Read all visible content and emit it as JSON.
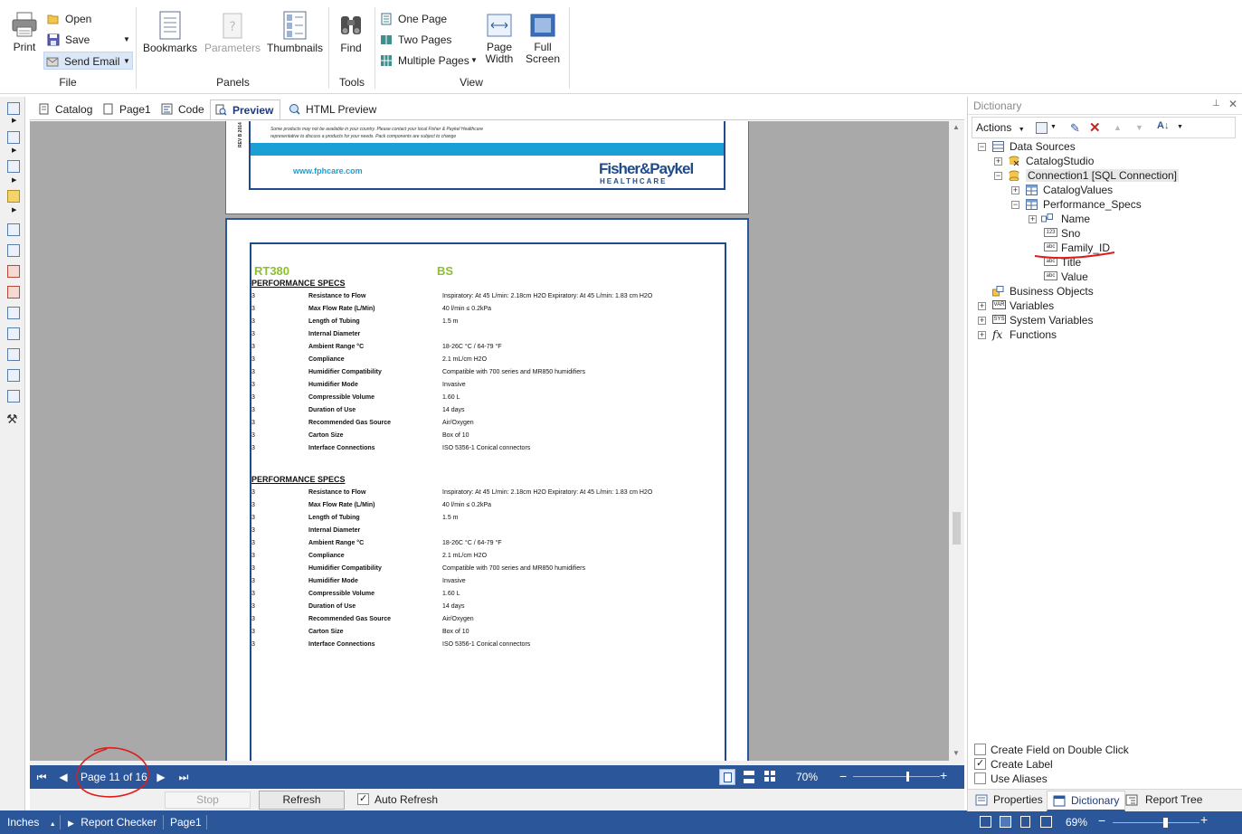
{
  "ribbon": {
    "print": "Print",
    "open": "Open",
    "save": "Save",
    "send_email": "Send Email",
    "file_group": "File",
    "bookmarks": "Bookmarks",
    "parameters": "Parameters",
    "thumbnails": "Thumbnails",
    "panels_group": "Panels",
    "find": "Find",
    "tools_group": "Tools",
    "one_page": "One Page",
    "two_pages": "Two Pages",
    "multiple_pages": "Multiple Pages",
    "page_width": "Page\nWidth",
    "page_width_l1": "Page",
    "page_width_l2": "Width",
    "full_screen_l1": "Full",
    "full_screen_l2": "Screen",
    "view_group": "View"
  },
  "tabs": [
    {
      "label": "Catalog"
    },
    {
      "label": "Page1"
    },
    {
      "label": "Code"
    },
    {
      "label": "Preview"
    },
    {
      "label": "HTML Preview"
    }
  ],
  "page_top": {
    "disclaimer1": "Some products may not be available in your country. Please contact your local Fisher & Paykel Healthcare",
    "disclaimer2": "representative to discuss a products for your needs. Pack components are subject to change",
    "website": "www.fphcare.com",
    "brand": "Fisher&Paykel",
    "brand_sub": "HEALTHCARE",
    "side_code": "REV B 2014"
  },
  "page_main": {
    "product": "RT380",
    "code": "BS",
    "sections": [
      {
        "heading": "PERFORMANCE SPECS",
        "rows": [
          {
            "n": "3",
            "name": "Resistance to Flow",
            "value": "Inspiratory: At 45 L/min: 2.18cm H2O Expiratory: At 45 L/min: 1.83 cm H2O"
          },
          {
            "n": "3",
            "name": "Max Flow Rate (L/Min)",
            "value": "40 l/min ≤ 0.2kPa"
          },
          {
            "n": "3",
            "name": "Length of Tubing",
            "value": "1.5 m"
          },
          {
            "n": "3",
            "name": "Internal Diameter",
            "value": ""
          },
          {
            "n": "3",
            "name": "Ambient Range °C",
            "value": "18-26C °C / 64-79 °F"
          },
          {
            "n": "3",
            "name": "Compliance",
            "value": "2.1 mL/cm H2O"
          },
          {
            "n": "3",
            "name": "Humidifier Compatibility",
            "value": "Compatible with 700 series and MR850 humidifiers"
          },
          {
            "n": "3",
            "name": "Humidifier Mode",
            "value": "Invasive"
          },
          {
            "n": "3",
            "name": "Compressible Volume",
            "value": "1.60 L"
          },
          {
            "n": "3",
            "name": "Duration of Use",
            "value": "14 days"
          },
          {
            "n": "3",
            "name": "Recommended Gas Source",
            "value": "Air/Oxygen"
          },
          {
            "n": "3",
            "name": "Carton Size",
            "value": "Box of 10"
          },
          {
            "n": "3",
            "name": "Interface Connections",
            "value": "ISO 5356-1 Conical connectors"
          }
        ]
      },
      {
        "heading": "PERFORMANCE SPECS",
        "rows": [
          {
            "n": "3",
            "name": "Resistance to Flow",
            "value": "Inspiratory: At 45 L/min: 2.18cm H2O Expiratory: At 45 L/min: 1.83 cm H2O"
          },
          {
            "n": "3",
            "name": "Max Flow Rate (L/Min)",
            "value": "40 l/min ≤ 0.2kPa"
          },
          {
            "n": "3",
            "name": "Length of Tubing",
            "value": "1.5 m"
          },
          {
            "n": "3",
            "name": "Internal Diameter",
            "value": ""
          },
          {
            "n": "3",
            "name": "Ambient Range °C",
            "value": "18-26C °C / 64-79 °F"
          },
          {
            "n": "3",
            "name": "Compliance",
            "value": "2.1 mL/cm H2O"
          },
          {
            "n": "3",
            "name": "Humidifier Compatibility",
            "value": "Compatible with 700 series and MR850 humidifiers"
          },
          {
            "n": "3",
            "name": "Humidifier Mode",
            "value": "Invasive"
          },
          {
            "n": "3",
            "name": "Compressible Volume",
            "value": "1.60 L"
          },
          {
            "n": "3",
            "name": "Duration of Use",
            "value": "14 days"
          },
          {
            "n": "3",
            "name": "Recommended Gas Source",
            "value": "Air/Oxygen"
          },
          {
            "n": "3",
            "name": "Carton Size",
            "value": "Box of 10"
          },
          {
            "n": "3",
            "name": "Interface Connections",
            "value": "ISO 5356-1 Conical connectors"
          }
        ]
      }
    ]
  },
  "navbar": {
    "page_indicator": "Page 11 of 16",
    "zoom": "70%",
    "zoom_level": 0.62
  },
  "bottombar": {
    "stop": "Stop",
    "refresh": "Refresh",
    "auto_refresh": "Auto Refresh",
    "auto_refresh_checked": true
  },
  "statusbar": {
    "units": "Inches",
    "report_checker": "Report Checker",
    "page": "Page1",
    "zoom": "69%",
    "zoom_level": 0.6
  },
  "dictionary": {
    "title": "Dictionary",
    "actions": "Actions",
    "tree": {
      "data_sources": "Data Sources",
      "catalog_studio": "CatalogStudio",
      "connection": "Connection1 [SQL Connection]",
      "catalog_values": "CatalogValues",
      "performance_specs": "Performance_Specs",
      "name": "Name",
      "sno": "Sno",
      "family_id": "Family_ID",
      "title": "Title",
      "value": "Value",
      "business_objects": "Business Objects",
      "variables": "Variables",
      "system_variables": "System Variables",
      "functions": "Functions"
    },
    "create_field_on_double_click": "Create Field on Double Click",
    "create_label": "Create Label",
    "create_label_checked": true,
    "use_aliases": "Use Aliases",
    "tabs": [
      {
        "label": "Properties"
      },
      {
        "label": "Dictionary"
      },
      {
        "label": "Report Tree"
      }
    ]
  },
  "colors": {
    "accent_blue": "#2b579a",
    "brand_blue": "#1f4a8c",
    "cyan_band": "#1aa0d4",
    "product_green": "#8dbf2e",
    "annotation_red": "#e01b1b"
  }
}
